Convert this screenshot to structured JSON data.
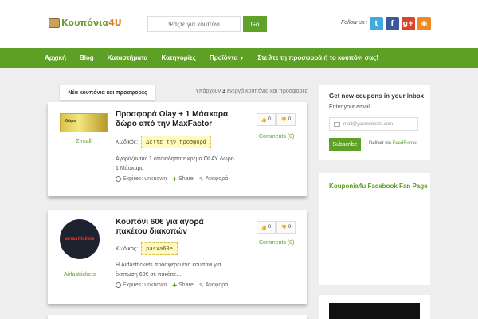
{
  "header": {
    "logo_text": "Κουπόνια",
    "logo_suffix": "4U",
    "search_placeholder": "Ψάξτε για κουπόνι",
    "search_button": "Go",
    "follow_label": "Follow us :",
    "social": [
      {
        "name": "twitter",
        "glyph": "t"
      },
      {
        "name": "facebook",
        "glyph": "f"
      },
      {
        "name": "google-plus",
        "glyph": "g+"
      },
      {
        "name": "rss",
        "glyph": "◉"
      }
    ]
  },
  "nav": {
    "items": [
      "Αρχική",
      "Blog",
      "Καταστήματα",
      "Κατηγορίες",
      "Προϊόντα",
      "Στείλτε τη προσφορά ή το κουπόνι σας!"
    ],
    "dropdown_caret": "▼"
  },
  "main": {
    "tab_label": "Νέα κουπόνια και προσφορές",
    "count_prefix": "Υπάρχουν",
    "count_value": "3",
    "count_suffix": "ενεργά κουπόνια και προσφορές",
    "coupons": [
      {
        "thumb_text": "δώρο",
        "store": "Z-mall",
        "title": "Προσφορά Olay + 1 Μάσκαρα δώρο από την MaxFactor",
        "code_label": "Κωδικός:",
        "code": "Δείτε την προσφορά",
        "description": "Αγοράζοντας 1 οποιαδήποτε κρέμα OLAY Δώρο 1 Μάσκαρα",
        "expires": "Expires: unknown",
        "share": "Share",
        "report": "Αναφορά",
        "votes_up": "0",
        "votes_down": "0",
        "comments": "Comments (0)"
      },
      {
        "thumb_text_a": "airfast",
        "thumb_text_b": "tickets",
        "store": "Airfasttickets",
        "title": "Κουπόνι 60€ για αγορά πακέτου διακοπών",
        "code_label": "Κωδικός:",
        "code": "pasxa60e",
        "description": "Η Airfasttickets προσφέρει ένα κουπόνι για έκπτωση 60€ σε πακέτα:...",
        "expires": "Expires: unknown",
        "share": "Share",
        "report": "Αναφορά",
        "votes_up": "0",
        "votes_down": "0",
        "comments": "Comments (0)"
      }
    ]
  },
  "sidebar": {
    "newsletter_title": "Get new coupons in your inbox",
    "email_label": "Enter your email",
    "email_placeholder": "mail@yourwebsite.com",
    "subscribe_button": "Subscribe",
    "deliver_prefix": "Deliver via",
    "deliver_link": "FeedBurner",
    "fb_title": "Kouponia4u Facebook Fan Page"
  },
  "colors": {
    "brand_green": "#5e9f25",
    "accent_orange": "#e07b1a"
  }
}
